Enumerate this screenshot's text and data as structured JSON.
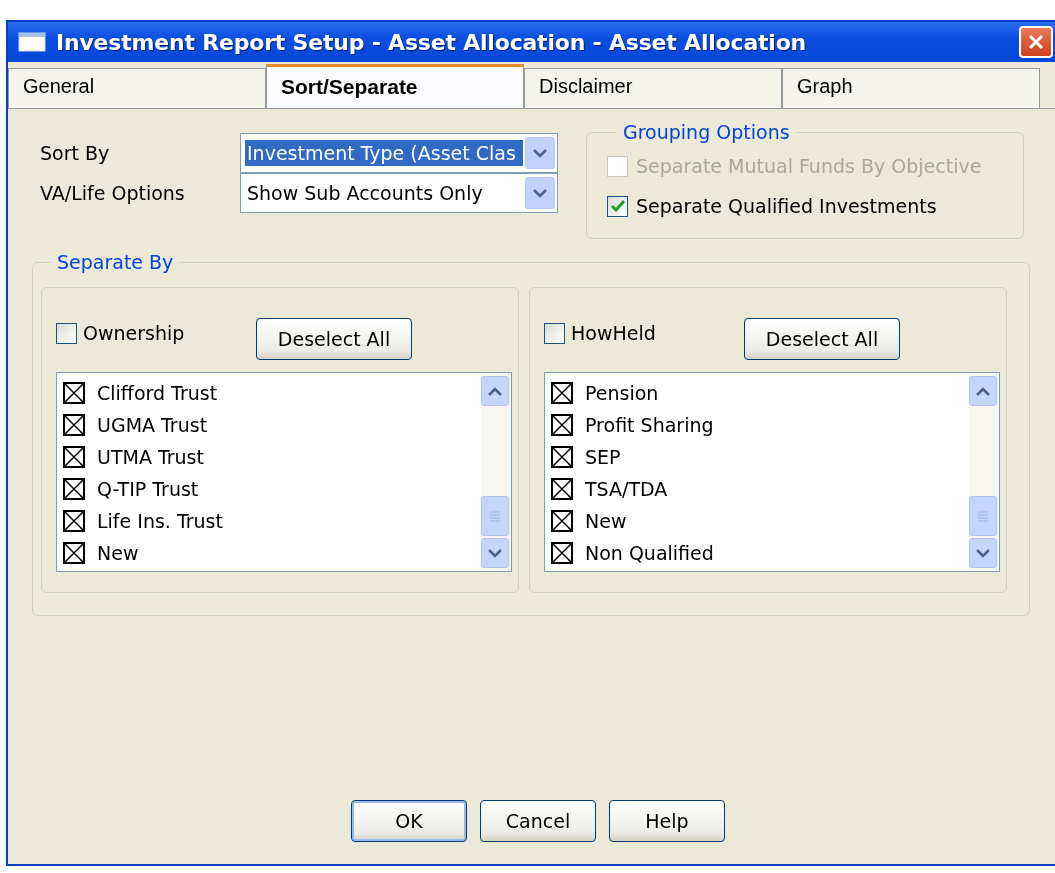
{
  "window": {
    "title": "Investment Report Setup - Asset Allocation - Asset Allocation"
  },
  "tabs": [
    {
      "label": "General",
      "selected": false
    },
    {
      "label": "Sort/Separate",
      "selected": true
    },
    {
      "label": "Disclaimer",
      "selected": false
    },
    {
      "label": "Graph",
      "selected": false
    }
  ],
  "sort_options": [
    {
      "label": "Sort By",
      "value": "Investment Type (Asset Clas",
      "highlighted": true
    },
    {
      "label": "VA/Life Options",
      "value": "Show Sub Accounts Only",
      "highlighted": false
    }
  ],
  "grouping_options": {
    "title": "Grouping Options",
    "options": [
      {
        "label": "Separate Mutual Funds By Objective",
        "checked": false,
        "disabled": true
      },
      {
        "label": "Separate Qualified Investments",
        "checked": true,
        "disabled": false
      }
    ]
  },
  "separate_by": {
    "title": "Separate By",
    "groups": [
      {
        "label": "Ownership",
        "checked": false,
        "button": "Deselect All",
        "items": [
          {
            "label": "Clifford Trust",
            "checked": true
          },
          {
            "label": "UGMA Trust",
            "checked": true
          },
          {
            "label": "UTMA Trust",
            "checked": true
          },
          {
            "label": "Q-TIP Trust",
            "checked": true
          },
          {
            "label": "Life Ins. Trust",
            "checked": true
          },
          {
            "label": "New",
            "checked": true
          }
        ]
      },
      {
        "label": "HowHeld",
        "checked": false,
        "button": "Deselect All",
        "items": [
          {
            "label": "Pension",
            "checked": true
          },
          {
            "label": "Profit Sharing",
            "checked": true
          },
          {
            "label": "SEP",
            "checked": true
          },
          {
            "label": "TSA/TDA",
            "checked": true
          },
          {
            "label": "New",
            "checked": true
          },
          {
            "label": "Non Qualified",
            "checked": true
          }
        ]
      }
    ]
  },
  "buttons": [
    {
      "label": "OK",
      "default": true
    },
    {
      "label": "Cancel",
      "default": false
    },
    {
      "label": "Help",
      "default": false
    }
  ]
}
